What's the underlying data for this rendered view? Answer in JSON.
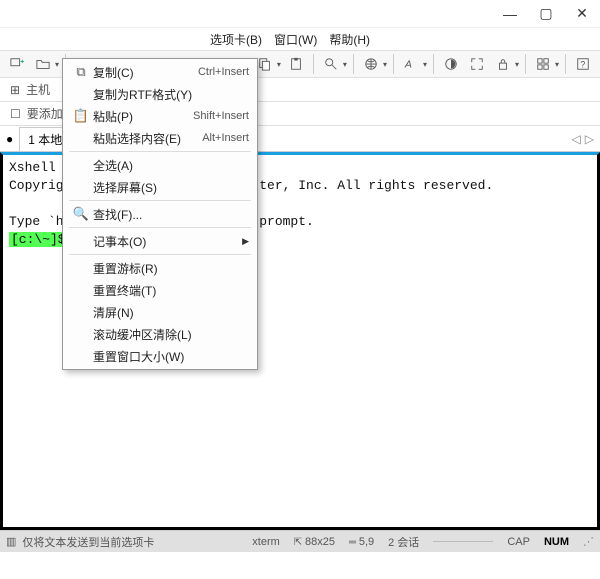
{
  "window": {
    "min": "—",
    "max": "▢",
    "close": "✕"
  },
  "menubar": {
    "tabs": "选项卡(B)",
    "window": "窗口(W)",
    "help": "帮助(H)"
  },
  "subbar": {
    "host_label": "主机",
    "add_favorites": "要添加"
  },
  "tab": {
    "label": "1 本地S"
  },
  "tabnav": {
    "left": "◁",
    "right": "▷"
  },
  "terminal": {
    "line1": "Xshell 5",
    "line2_a": "Copyright",
    "line2_b": "ter, Inc. All rights reserved.",
    "line3_a": "Type `hel",
    "line3_b": "prompt.",
    "prompt": "[c:\\~]$"
  },
  "context": {
    "copy": "复制(C)",
    "copy_accel": "Ctrl+Insert",
    "copy_rtf": "复制为RTF格式(Y)",
    "paste": "粘贴(P)",
    "paste_accel": "Shift+Insert",
    "paste_sel": "粘贴选择内容(E)",
    "paste_sel_accel": "Alt+Insert",
    "select_all": "全选(A)",
    "select_screen": "选择屏幕(S)",
    "find": "查找(F)...",
    "notepad": "记事本(O)",
    "reset_cursor": "重置游标(R)",
    "reset_terminal": "重置终端(T)",
    "clear": "清屏(N)",
    "scroll_clear": "滚动缓冲区清除(L)",
    "reset_winsize": "重置窗口大小(W)"
  },
  "status": {
    "send_text": "仅将文本发送到当前选项卡",
    "term": "xterm",
    "size": "88x25",
    "cursor": "5,9",
    "sessions": "2 会话",
    "cap": "CAP",
    "num": "NUM"
  }
}
